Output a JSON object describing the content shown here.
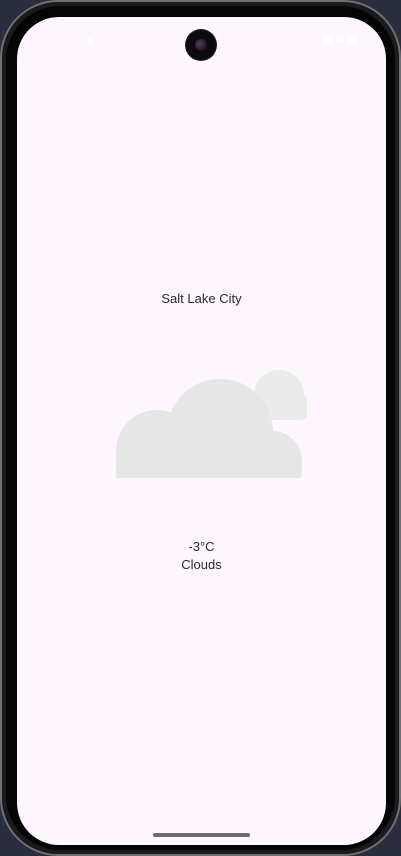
{
  "app": {
    "city": "Salt Lake City",
    "temperature": "-3°C",
    "condition": "Clouds",
    "weather_icon": "cloud-icon"
  },
  "colors": {
    "background": "#fdf6fe",
    "text": "#2b2b2f",
    "cloud": "#e8e8e8"
  }
}
